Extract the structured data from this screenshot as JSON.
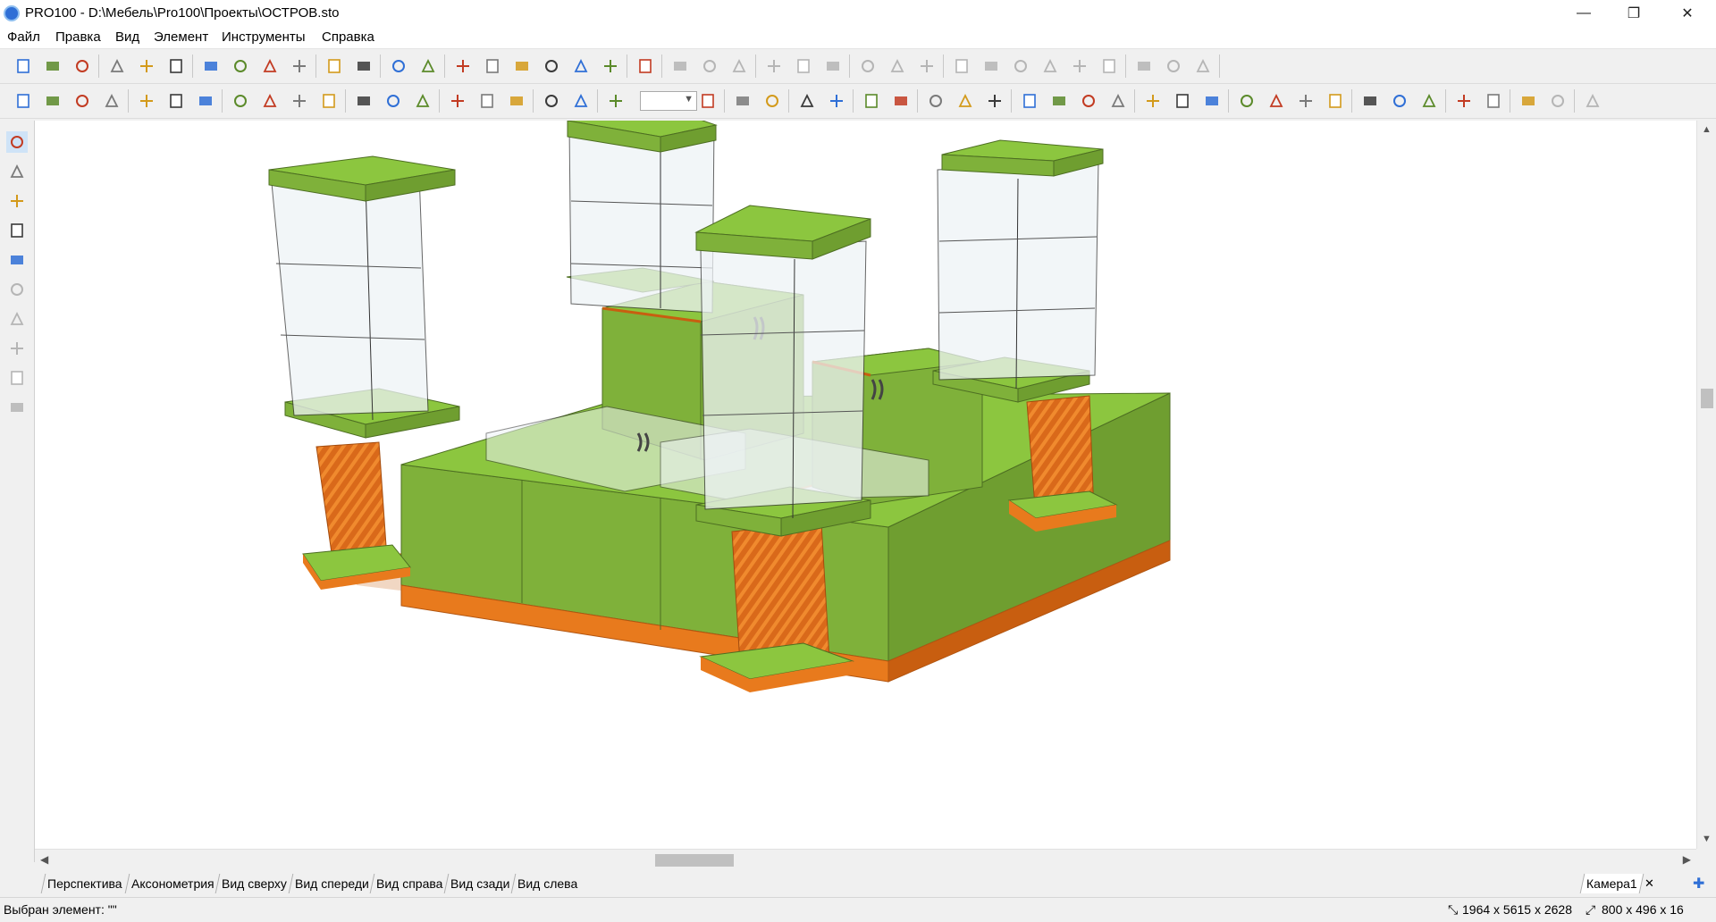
{
  "window": {
    "title": "PRO100 - D:\\Мебель\\Pro100\\Проекты\\ОСТРОВ.sto",
    "controls": {
      "minimize": "—",
      "restore": "❐",
      "close": "✕"
    }
  },
  "menu": [
    "Файл",
    "Правка",
    "Вид",
    "Элемент",
    "Инструменты",
    "Справка"
  ],
  "toolbar1": {
    "icons": [
      "new-file-icon",
      "open-folder-icon",
      "save-icon",
      "edit-properties-icon",
      "print-icon",
      "print-preview-icon",
      "cut-icon",
      "copy-icon",
      "paste-icon",
      "delete-icon",
      "undo-icon",
      "redo-icon",
      "library-icon",
      "checklist-icon",
      "report-icon",
      "preview-report-icon",
      "order-icon",
      "dimensions-report-icon",
      "export-image-icon",
      "settings-report-icon",
      "sum-icon",
      "align-left-icon",
      "align-center-icon",
      "align-right-icon",
      "align-top-icon",
      "align-middle-icon",
      "align-bottom-icon",
      "distribute-h-icon",
      "distribute-v-icon",
      "distribute-d-icon",
      "stack-left-icon",
      "stack-center-icon",
      "stack-right-icon",
      "stack-top-icon",
      "stack-middle-icon",
      "stack-bottom-icon",
      "group-1-icon",
      "group-2-icon",
      "group-3-icon"
    ]
  },
  "toolbar2": {
    "icons": [
      "wireframe-icon",
      "box-icon",
      "solid-icon",
      "shaded-icon",
      "front-icon",
      "side-icon",
      "cube-icon",
      "text-icon",
      "material-icon",
      "light-icon",
      "texture-icon",
      "dimension-icon",
      "grid-icon",
      "eye-icon",
      "snap-point-icon",
      "snap-edge-icon",
      "snap-face-icon",
      "magnet-icon",
      "target-icon",
      "zoom-out-icon",
      "zoom-in-icon",
      "move-left-icon",
      "move-right-icon",
      "move-up-icon",
      "move-down-icon",
      "rotate-face-icon",
      "rotate-back-icon",
      "center-h-icon",
      "center-v-icon",
      "center-d-icon",
      "width-icon",
      "width2-icon",
      "height-icon",
      "height2-icon",
      "select-grid-icon",
      "group-select-icon",
      "ungroup-icon",
      "rotate-left-icon",
      "rotate-right-icon",
      "refresh-icon",
      "move-all-icon",
      "mirror-icon",
      "fit-icon",
      "edge-band-icon",
      "hide-icon",
      "show-icon",
      "eye-hide-icon",
      "eye-show-icon",
      "help-ring-icon"
    ],
    "zoom_value": ""
  },
  "leftbar": [
    "pointer-icon",
    "hatch-icon",
    "ruler-icon",
    "eyedropper-icon",
    "rectangle-select-icon",
    "align-panel-icon",
    "side-panel-icon",
    "side-panel2-icon",
    "shelf-icon",
    "magnifier-icon"
  ],
  "tabs": [
    "Перспектива",
    "Аксонометрия",
    "Вид сверху",
    "Вид спереди",
    "Вид справа",
    "Вид сзади",
    "Вид слева"
  ],
  "camera_tab": "Камера1",
  "status": {
    "selected": "Выбран элемент: \"\"",
    "dimensions": "1964 x 5615 x 2628",
    "viewport": "800 x 496 x 16"
  },
  "colors": {
    "green_top": "#8cc63f",
    "green_side": "#7fb13a",
    "green_dark": "#6f9e30",
    "orange": "#e87a1d",
    "orange_dark": "#c85e10",
    "glass": "#eef3f6"
  }
}
